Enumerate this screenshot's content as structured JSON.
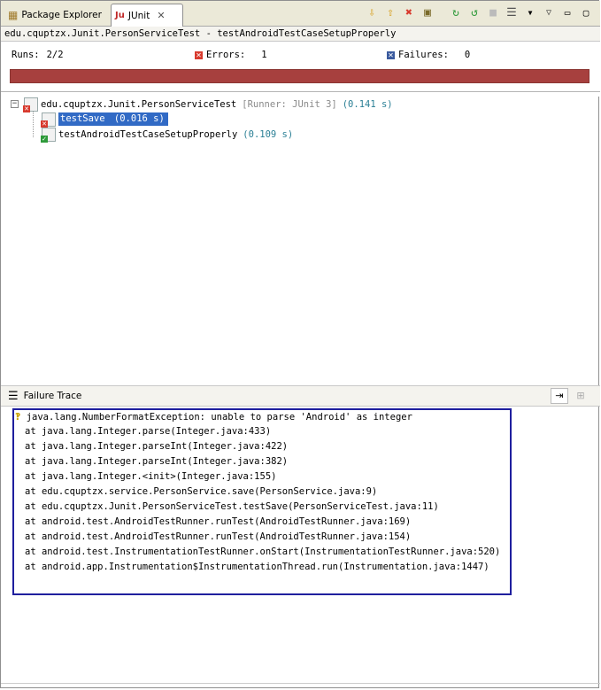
{
  "tabs": [
    {
      "label": "Package Explorer",
      "icon": "package-explorer-icon",
      "active": false
    },
    {
      "label": "JUnit",
      "icon": "junit-icon",
      "active": true
    }
  ],
  "title": "edu.cquptzx.Junit.PersonServiceTest - testAndroidTestCaseSetupProperly",
  "counters": {
    "runs_label": "Runs:",
    "runs_value": "2/2",
    "errors_label": "Errors:",
    "errors_value": "1",
    "failures_label": "Failures:",
    "failures_value": "0"
  },
  "progress": {
    "status": "failed",
    "color": "#a7403e",
    "fraction": 1.0
  },
  "tree": {
    "suite_name": "edu.cquptzx.Junit.PersonServiceTest",
    "suite_runner": "[Runner: JUnit 3]",
    "suite_time": "(0.141 s)",
    "tests": [
      {
        "name": "testSave",
        "time": "(0.016 s)",
        "status": "error",
        "selected": true
      },
      {
        "name": "testAndroidTestCaseSetupProperly",
        "time": "(0.109 s)",
        "status": "ok",
        "selected": false
      }
    ]
  },
  "trace": {
    "header": "Failure Trace",
    "exception": "java.lang.NumberFormatException: unable to parse 'Android' as integer",
    "lines": [
      "at java.lang.Integer.parse(Integer.java:433)",
      "at java.lang.Integer.parseInt(Integer.java:422)",
      "at java.lang.Integer.parseInt(Integer.java:382)",
      "at java.lang.Integer.<init>(Integer.java:155)",
      "at edu.cquptzx.service.PersonService.save(PersonService.java:9)",
      "at edu.cquptzx.Junit.PersonServiceTest.testSave(PersonServiceTest.java:11)",
      "at android.test.AndroidTestRunner.runTest(AndroidTestRunner.java:169)",
      "at android.test.AndroidTestRunner.runTest(AndroidTestRunner.java:154)",
      "at android.test.InstrumentationTestRunner.onStart(InstrumentationTestRunner.java:520)",
      "at android.app.Instrumentation$InstrumentationThread.run(Instrumentation.java:1447)"
    ]
  },
  "colors": {
    "error": "#d83a2e",
    "ok": "#2e9a3a",
    "selection": "#316ac5",
    "trace_border": "#1f1f9e"
  }
}
